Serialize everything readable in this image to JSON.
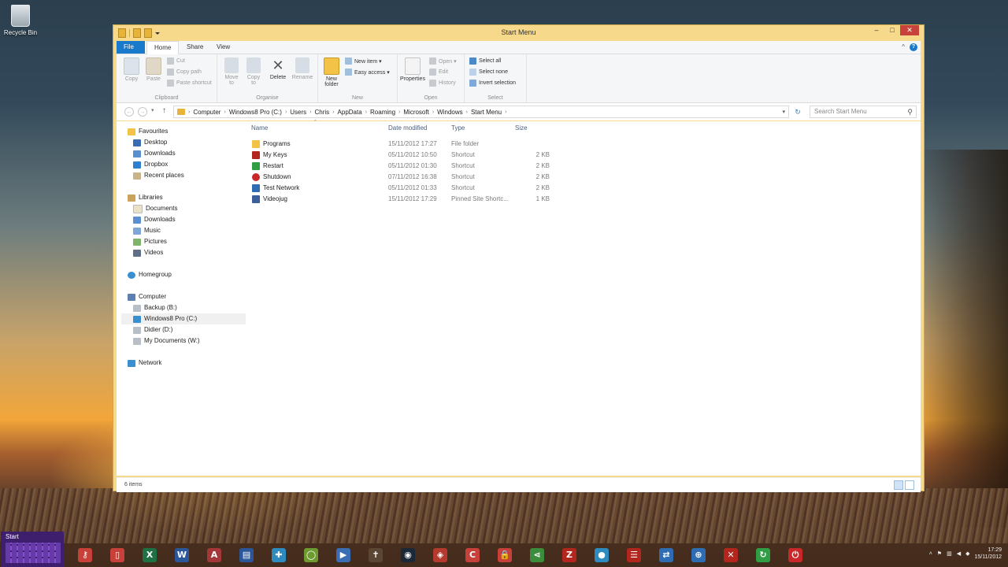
{
  "desktop": {
    "recycle_bin_label": "Recycle Bin"
  },
  "window": {
    "title": "Start Menu",
    "controls": {
      "minimize": "–",
      "maximize": "□",
      "close": "✕"
    }
  },
  "ribbon": {
    "tabs": [
      "File",
      "Home",
      "Share",
      "View"
    ],
    "help": "?",
    "collapse": "^",
    "clipboard": {
      "label": "Clipboard",
      "copy": "Copy",
      "paste": "Paste",
      "cut": "Cut",
      "copy_path": "Copy path",
      "paste_shortcut": "Paste shortcut"
    },
    "organise": {
      "label": "Organise",
      "move_to": "Move to",
      "copy_to": "Copy to",
      "delete": "Delete",
      "rename": "Rename"
    },
    "new": {
      "label": "New",
      "new_folder": "New folder",
      "new_item": "New item ▾",
      "easy_access": "Easy access ▾"
    },
    "open": {
      "label": "Open",
      "properties": "Properties",
      "open": "Open ▾",
      "edit": "Edit",
      "history": "History"
    },
    "select": {
      "label": "Select",
      "select_all": "Select all",
      "select_none": "Select none",
      "invert_selection": "Invert selection"
    }
  },
  "address": {
    "breadcrumbs": [
      "Computer",
      "Windows8 Pro (C:)",
      "Users",
      "Chris",
      "AppData",
      "Roaming",
      "Microsoft",
      "Windows",
      "Start Menu"
    ],
    "search_placeholder": "Search Start Menu"
  },
  "nav": {
    "favourites": {
      "label": "Favourites",
      "items": [
        "Desktop",
        "Downloads",
        "Dropbox",
        "Recent places"
      ]
    },
    "libraries": {
      "label": "Libraries",
      "items": [
        "Documents",
        "Downloads",
        "Music",
        "Pictures",
        "Videos"
      ]
    },
    "homegroup": "Homegroup",
    "computer": {
      "label": "Computer",
      "items": [
        "Backup (B:)",
        "Windows8 Pro (C:)",
        "Didier (D:)",
        "My Documents (W:)"
      ]
    },
    "network": "Network"
  },
  "files": {
    "columns": {
      "name": "Name",
      "date": "Date modified",
      "type": "Type",
      "size": "Size"
    },
    "rows": [
      {
        "name": "Programs",
        "date": "15/11/2012 17:27",
        "type": "File folder",
        "size": ""
      },
      {
        "name": "My Keys",
        "date": "05/11/2012 10:50",
        "type": "Shortcut",
        "size": "2 KB"
      },
      {
        "name": "Restart",
        "date": "05/11/2012 01:30",
        "type": "Shortcut",
        "size": "2 KB"
      },
      {
        "name": "Shutdown",
        "date": "07/11/2012 16:38",
        "type": "Shortcut",
        "size": "2 KB"
      },
      {
        "name": "Test Network",
        "date": "05/11/2012 01:33",
        "type": "Shortcut",
        "size": "2 KB"
      },
      {
        "name": "Videojug",
        "date": "15/11/2012 17:29",
        "type": "Pinned Site Shortc...",
        "size": "1 KB"
      }
    ]
  },
  "status": {
    "item_count": "6 items"
  },
  "taskbar": {
    "start_label": "Start",
    "apps": [
      {
        "name": "keys-app-icon",
        "glyph": "⚷",
        "color": "#c8403a"
      },
      {
        "name": "phone-app-icon",
        "glyph": "▯",
        "color": "#c8403a"
      },
      {
        "name": "excel-app-icon",
        "glyph": "X",
        "color": "#1e7145"
      },
      {
        "name": "word-app-icon",
        "glyph": "W",
        "color": "#2b579a"
      },
      {
        "name": "access-app-icon",
        "glyph": "A",
        "color": "#a4373a"
      },
      {
        "name": "calendar-app-icon",
        "glyph": "▤",
        "color": "#2b579a"
      },
      {
        "name": "maps-app-icon",
        "glyph": "✚",
        "color": "#2e8bc0"
      },
      {
        "name": "oval-app-icon",
        "glyph": "◯",
        "color": "#6e9b2f"
      },
      {
        "name": "video-app-icon",
        "glyph": "▶",
        "color": "#3a6db3"
      },
      {
        "name": "cross-app-icon",
        "glyph": "✝",
        "color": "#5a4632"
      },
      {
        "name": "steam-app-icon",
        "glyph": "◉",
        "color": "#1b2838"
      },
      {
        "name": "puzzle-app-icon",
        "glyph": "◈",
        "color": "#b33a2c"
      },
      {
        "name": "ccleaner-app-icon",
        "glyph": "C",
        "color": "#c8403a"
      },
      {
        "name": "lock-app-icon",
        "glyph": "🔒",
        "color": "#c8403a"
      },
      {
        "name": "share-app-icon",
        "glyph": "⋖",
        "color": "#3b8c3b"
      },
      {
        "name": "filezilla-app-icon",
        "glyph": "Z",
        "color": "#b3261e"
      },
      {
        "name": "disc-app-icon",
        "glyph": "●",
        "color": "#2e8bc0"
      },
      {
        "name": "list-app-icon",
        "glyph": "☰",
        "color": "#b3261e"
      },
      {
        "name": "sync-app-icon",
        "glyph": "⇄",
        "color": "#2e6db3"
      },
      {
        "name": "target-app-icon",
        "glyph": "⊕",
        "color": "#2e6db3"
      },
      {
        "name": "xmark-app-icon",
        "glyph": "✕",
        "color": "#b3261e"
      },
      {
        "name": "refresh-app-icon",
        "glyph": "↻",
        "color": "#2f9e44"
      },
      {
        "name": "power-app-icon",
        "glyph": "⏻",
        "color": "#c8282a"
      }
    ],
    "clock_time": "17:29",
    "clock_date": "15/11/2012"
  }
}
